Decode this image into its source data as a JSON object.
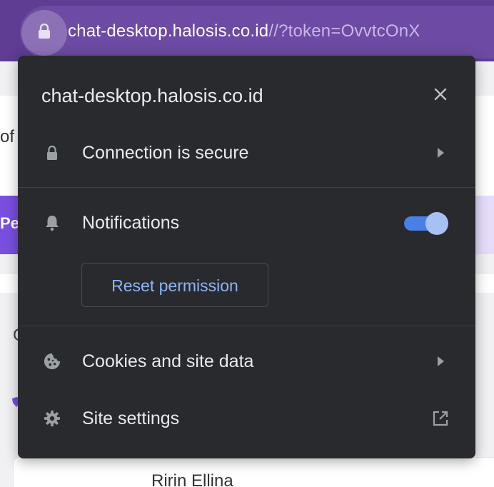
{
  "address_bar": {
    "url_host": "chat-desktop.halosis.co.id",
    "url_rest": "//?token=OvvtcOnX"
  },
  "background": {
    "partial_text": "of",
    "button_partial": "Pe",
    "card_partial": "C",
    "contact_name": "Ririn Ellina"
  },
  "popup": {
    "title": "chat-desktop.halosis.co.id",
    "connection": {
      "label": "Connection is secure"
    },
    "notifications": {
      "label": "Notifications",
      "enabled": true
    },
    "reset_button": "Reset permission",
    "cookies": {
      "label": "Cookies and site data"
    },
    "site_settings": {
      "label": "Site settings"
    }
  },
  "colors": {
    "toolbar": "#5e3d92",
    "popup_bg": "#292a2d",
    "link_blue": "#8ab4f8",
    "toggle_on": "#4a7fe6"
  },
  "icons": {
    "address_lock": "lock-icon",
    "close": "close-icon",
    "connection": "lock-icon",
    "notifications": "bell-icon",
    "cookies": "cookie-icon",
    "site_settings": "gear-icon",
    "chevron": "chevron-right-icon",
    "external": "open-in-new-icon"
  }
}
